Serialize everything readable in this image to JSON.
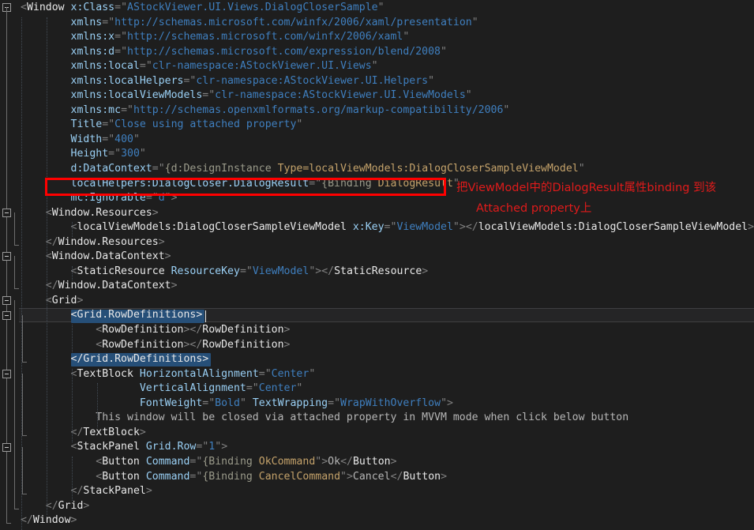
{
  "editor": {
    "language": "XAML",
    "background": "#1e1e1e",
    "current_line_index": 20,
    "caret_line": 20,
    "colors": {
      "background": "#1e1e1e",
      "current_line": "#252526",
      "current_line_border": "#3f3f41",
      "tag": "#e8e8e8",
      "attribute": "#9ad0f5",
      "value": "#3f7fbf",
      "text": "#b6b6b6",
      "punctuation": "#808080",
      "markup_extension": "#9a9a8a",
      "binding_path": "#c4a26a",
      "selection": "#264f78",
      "annotation": "#e01b1b",
      "indent_guide": "#4a5560"
    }
  },
  "annotation": {
    "line1": "把ViewModel中的DialogResult属性binding 到该",
    "line2": "Attached property上",
    "highlight_target": "localHelpers:DialogCloser.DialogResult=\"{Binding DialogResult}\""
  },
  "code_lines": [
    {
      "n": 1,
      "indent": 0,
      "text": "<Window x:Class=\"AStockViewer.UI.Views.DialogCloserSample\""
    },
    {
      "n": 2,
      "indent": 8,
      "text": "xmlns=\"http://schemas.microsoft.com/winfx/2006/xaml/presentation\""
    },
    {
      "n": 3,
      "indent": 8,
      "text": "xmlns:x=\"http://schemas.microsoft.com/winfx/2006/xaml\""
    },
    {
      "n": 4,
      "indent": 8,
      "text": "xmlns:d=\"http://schemas.microsoft.com/expression/blend/2008\""
    },
    {
      "n": 5,
      "indent": 8,
      "text": "xmlns:local=\"clr-namespace:AStockViewer.UI.Views\""
    },
    {
      "n": 6,
      "indent": 8,
      "text": "xmlns:localHelpers=\"clr-namespace:AStockViewer.UI.Helpers\""
    },
    {
      "n": 7,
      "indent": 8,
      "text": "xmlns:localViewModels=\"clr-namespace:AStockViewer.UI.ViewModels\""
    },
    {
      "n": 8,
      "indent": 8,
      "text": "xmlns:mc=\"http://schemas.openxmlformats.org/markup-compatibility/2006\""
    },
    {
      "n": 9,
      "indent": 8,
      "text": "Title=\"Close using attached property\""
    },
    {
      "n": 10,
      "indent": 8,
      "text": "Width=\"400\""
    },
    {
      "n": 11,
      "indent": 8,
      "text": "Height=\"300\""
    },
    {
      "n": 12,
      "indent": 8,
      "text": "d:DataContext=\"{d:DesignInstance Type=localViewModels:DialogCloserSampleViewModel}\""
    },
    {
      "n": 13,
      "indent": 8,
      "text": "localHelpers:DialogCloser.DialogResult=\"{Binding DialogResult}\""
    },
    {
      "n": 14,
      "indent": 8,
      "text": "mc:Ignorable=\"d\">"
    },
    {
      "n": 15,
      "indent": 4,
      "text": "<Window.Resources>"
    },
    {
      "n": 16,
      "indent": 8,
      "text": "<localViewModels:DialogCloserSampleViewModel x:Key=\"ViewModel\"></localViewModels:DialogCloserSampleViewModel>"
    },
    {
      "n": 17,
      "indent": 4,
      "text": "</Window.Resources>"
    },
    {
      "n": 18,
      "indent": 4,
      "text": "<Window.DataContext>"
    },
    {
      "n": 19,
      "indent": 8,
      "text": "<StaticResource ResourceKey=\"ViewModel\"></StaticResource>"
    },
    {
      "n": 20,
      "indent": 4,
      "text": "</Window.DataContext>"
    },
    {
      "n": 21,
      "indent": 4,
      "text": "<Grid>"
    },
    {
      "n": 22,
      "indent": 8,
      "text": "<Grid.RowDefinitions>"
    },
    {
      "n": 23,
      "indent": 12,
      "text": "<RowDefinition></RowDefinition>"
    },
    {
      "n": 24,
      "indent": 12,
      "text": "<RowDefinition></RowDefinition>"
    },
    {
      "n": 25,
      "indent": 8,
      "text": "</Grid.RowDefinitions>"
    },
    {
      "n": 26,
      "indent": 8,
      "text": "<TextBlock HorizontalAlignment=\"Center\""
    },
    {
      "n": 27,
      "indent": 19,
      "text": "VerticalAlignment=\"Center\""
    },
    {
      "n": 28,
      "indent": 19,
      "text": "FontWeight=\"Bold\" TextWrapping=\"WrapWithOverflow\">"
    },
    {
      "n": 29,
      "indent": 12,
      "text": "This window will be closed via attached property in MVVM mode when click below button"
    },
    {
      "n": 30,
      "indent": 8,
      "text": "</TextBlock>"
    },
    {
      "n": 31,
      "indent": 8,
      "text": "<StackPanel Grid.Row=\"1\">"
    },
    {
      "n": 32,
      "indent": 12,
      "text": "<Button Command=\"{Binding OkCommand}\">Ok</Button>"
    },
    {
      "n": 33,
      "indent": 12,
      "text": "<Button Command=\"{Binding CancelCommand}\">Cancel</Button>"
    },
    {
      "n": 34,
      "indent": 8,
      "text": "</StackPanel>"
    },
    {
      "n": 35,
      "indent": 4,
      "text": "</Grid>"
    },
    {
      "n": 36,
      "indent": 0,
      "text": "</Window>"
    }
  ]
}
